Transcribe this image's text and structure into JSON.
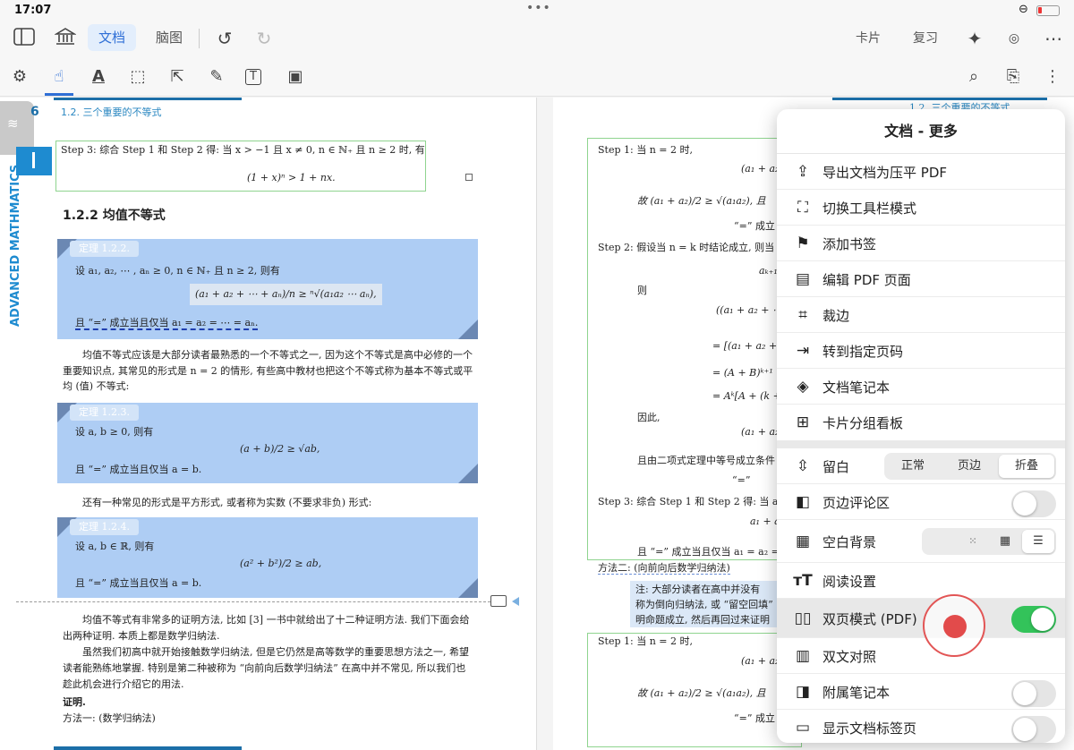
{
  "status": {
    "time": "17:07",
    "dots": "•••"
  },
  "toolbar": {
    "tab_doc": "文档",
    "tab_mindmap": "脑图",
    "card": "卡片",
    "review": "复习"
  },
  "left_page": {
    "page_number": "6",
    "section_header": "1.2.  三个重要的不等式",
    "side_title": "ADVANCED MATHMATICS",
    "step3": "Step 3: 综合 Step 1 和 Step 2 得: 当 x > −1 且 x ≠ 0, n ∈ ℕ₊ 且 n ≥ 2 时, 有",
    "step3_formula": "(1 + x)ⁿ > 1 + nx.",
    "subsection": "1.2.2   均值不等式",
    "thm1_title": "定理 1.2.2.",
    "thm1_line1": "设 a₁, a₂, ⋯ , aₙ ≥ 0, n ∈ ℕ₊ 且 n ≥ 2, 则有",
    "thm1_formula": "(a₁ + a₂ + ⋯ + aₙ)/n ≥ ⁿ√(a₁a₂ ⋯ aₙ),",
    "thm1_line3": "且 “=” 成立当且仅当 a₁ = a₂ = ⋯ = aₙ.",
    "para1_line1": "均值不等式应该是大部分读者最熟悉的一个不等式之一, 因为这个不等式是高中必修的一个",
    "para1_line2": "重要知识点, 其常见的形式是 n = 2 的情形, 有些高中教材也把这个不等式称为基本不等式或平",
    "para1_line3": "均 (值) 不等式:",
    "thm2_title": "定理 1.2.3.",
    "thm2_line1": "设 a, b ≥ 0, 则有",
    "thm2_formula": "(a + b)/2 ≥ √ab,",
    "thm2_line3": "且 “=” 成立当且仅当 a = b.",
    "para2": "还有一种常见的形式是平方形式, 或者称为实数 (不要求非负) 形式:",
    "thm3_title": "定理 1.2.4.",
    "thm3_line1": "设 a, b ∈ ℝ, 则有",
    "thm3_formula": "(a² + b²)/2 ≥ ab,",
    "thm3_line3": "且 “=” 成立当且仅当 a = b.",
    "para3_line1": "均值不等式有非常多的证明方法, 比如 [3] 一书中就给出了十二种证明方法. 我们下面会给",
    "para3_line2": "出两种证明. 本质上都是数学归纳法.",
    "para3_line3": "虽然我们初高中就开始接触数学归纳法, 但是它仍然是高等数学的重要思想方法之一, 希望",
    "para3_line4": "读者能熟练地掌握. 特别是第二种被称为 “向前向后数学归纳法” 在高中并不常见, 所以我们也",
    "para3_line5": "趁此机会进行介绍它的用法.",
    "proof": "证明.",
    "method1": "方法一: (数学归纳法)"
  },
  "right_page": {
    "header": "1.2.  三个重要的不等式",
    "step1": "Step 1: 当 n = 2 时,",
    "frac1": "(a₁ + a₂)/2",
    "step1b": "故 (a₁ + a₂)/2 ≥ √(a₁a₂), 且",
    "eq_hold": "“=” 成立",
    "step2": "Step 2: 假设当 n = k 时结论成立, 则当",
    "ak1": "aₖ₊₁",
    "then": "则",
    "line_a": "((a₁ + a₂ + ⋯ )/(k + 1)",
    "line_b": "= [(a₁ + a₂ + ⋯)/k",
    "line_c": "= (A + B)ᵏ⁺¹ ≥ A",
    "line_d": "= Aᵏ[A + (k + 1)",
    "therefore": "因此,",
    "frac_k": "(a₁ + a₂ + ⋯)/k",
    "binom": "且由二项式定理中等号成立条件",
    "eq2": "“=”",
    "step3": "Step 3: 综合 Step 1 和 Step 2 得: 当 a₁",
    "frac3": "a₁ + a₂",
    "step3b": "且 “=” 成立当且仅当 a₁ = a₂ =",
    "method2": "方法二: (向前向后数学归纳法)",
    "note1": "注:  大部分读者在高中并没有",
    "note2": "称为倒向归纳法, 或 “留空回填”",
    "note3": "明命题成立, 然后再回过来证明",
    "step1_again": "Step 1: 当 n = 2 时,",
    "frac1_again": "(a₁ + a₂)/2",
    "step1b_again": "故 (a₁ + a₂)/2 ≥ √(a₁a₂), 且",
    "eq_hold_again": "“=” 成立"
  },
  "menu": {
    "title": "文档 - 更多",
    "items": [
      {
        "icon": "share-icon",
        "label": "导出文档为压平 PDF"
      },
      {
        "icon": "expand-icon",
        "label": "切换工具栏模式"
      },
      {
        "icon": "bookmark-icon",
        "label": "添加书签"
      },
      {
        "icon": "edit-pdf-icon",
        "label": "编辑 PDF 页面"
      },
      {
        "icon": "crop-icon",
        "label": "裁边"
      },
      {
        "icon": "goto-page-icon",
        "label": "转到指定页码"
      },
      {
        "icon": "layers-icon",
        "label": "文档笔记本"
      },
      {
        "icon": "card-board-icon",
        "label": "卡片分组看板"
      }
    ],
    "margin": {
      "label": "留白",
      "options": [
        "正常",
        "页边",
        "折叠"
      ],
      "selected": "折叠"
    },
    "margin_comments": {
      "label": "页边评论区",
      "on": false
    },
    "blank_bg": {
      "label": "空白背景"
    },
    "reading": {
      "label": "阅读设置"
    },
    "dual_page": {
      "label": "双页模式 (PDF)",
      "on": true
    },
    "bilingual": {
      "label": "双文对照"
    },
    "attached_notebook": {
      "label": "附属笔记本",
      "on": false
    },
    "doc_tabs": {
      "label": "显示文档标签页",
      "on": false
    }
  },
  "colors": {
    "accent": "#2f6fd6",
    "toggle_on": "#33c35a",
    "theorem_bg": "#aecdf4",
    "touch": "#e24b4b"
  }
}
